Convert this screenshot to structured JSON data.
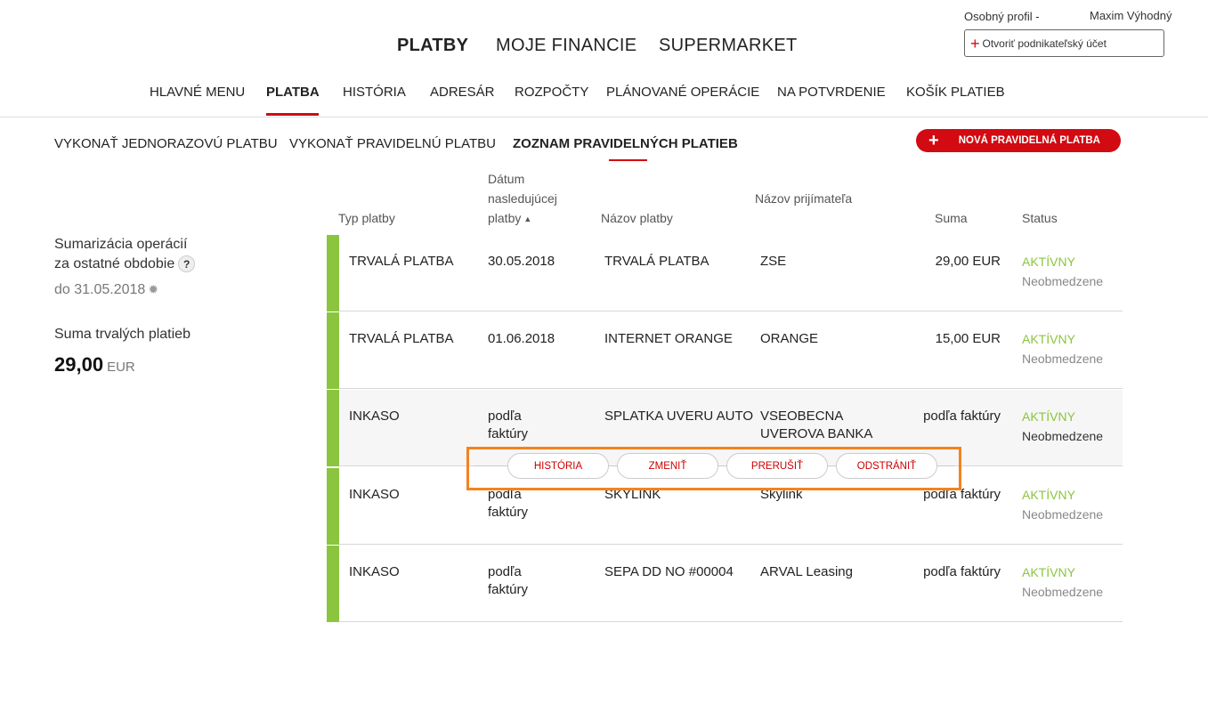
{
  "profile": {
    "label": "Osobný profil",
    "separator": "-",
    "name": "Maxim Výhodný",
    "business_button": "Otvoriť podnikateľský účet"
  },
  "top_nav": [
    "PLATBY",
    "MOJE FINANCIE",
    "SUPERMARKET"
  ],
  "sub_nav": [
    "HLAVNÉ MENU",
    "PLATBA",
    "HISTÓRIA",
    "ADRESÁR",
    "ROZPOČTY",
    "PLÁNOVANÉ OPERÁCIE",
    "NA POTVRDENIE",
    "KOŠÍK PLATIEB"
  ],
  "third_nav": [
    "VYKONAŤ JEDNORAZOVÚ PLATBU",
    "VYKONAŤ PRAVIDELNÚ PLATBU",
    "ZOZNAM PRAVIDELNÝCH PLATIEB"
  ],
  "new_button": "NOVÁ PRAVIDELNÁ PLATBA",
  "summary": {
    "title_line1": "Sumarizácia operácií",
    "title_line2": "za ostatné obdobie",
    "help": "?",
    "date": "do 31.05.2018",
    "sum_label": "Suma trvalých platieb",
    "sum_amount": "29,00",
    "sum_currency": "EUR"
  },
  "table": {
    "headers": {
      "type": "Typ platby",
      "date_l1": "Dátum",
      "date_l2": "nasledujúcej",
      "date_l3": "platby",
      "name": "Názov platby",
      "recipient": "Názov prijímateľa",
      "amount": "Suma",
      "status": "Status"
    },
    "rows": [
      {
        "type": "TRVALÁ PLATBA",
        "date": "30.05.2018",
        "date2": "",
        "name": "TRVALÁ PLATBA",
        "recipient": "ZSE",
        "recipient2": "",
        "amount": "29,00 EUR",
        "status": "AKTÍVNY",
        "status_sub": "Neobmedzene"
      },
      {
        "type": "TRVALÁ PLATBA",
        "date": "01.06.2018",
        "date2": "",
        "name": "INTERNET ORANGE",
        "recipient": "ORANGE",
        "recipient2": "",
        "amount": "15,00 EUR",
        "status": "AKTÍVNY",
        "status_sub": "Neobmedzene"
      },
      {
        "type": "INKASO",
        "date": "podľa",
        "date2": "faktúry",
        "name": "SPLATKA UVERU AUTO",
        "recipient": "VSEOBECNA",
        "recipient2": "UVEROVA BANKA",
        "amount": "podľa faktúry",
        "status": "AKTÍVNY",
        "status_sub": "Neobmedzene"
      },
      {
        "type": "INKASO",
        "date": "podľa",
        "date2": "faktúry",
        "name": "SKYLINK",
        "recipient": "Skylink",
        "recipient2": "",
        "amount": "podľa faktúry",
        "status": "AKTÍVNY",
        "status_sub": "Neobmedzene"
      },
      {
        "type": "INKASO",
        "date": "podľa",
        "date2": "faktúry",
        "name": "SEPA DD NO #00004",
        "recipient": "ARVAL Leasing",
        "recipient2": "",
        "amount": "podľa faktúry",
        "status": "AKTÍVNY",
        "status_sub": "Neobmedzene"
      }
    ]
  },
  "actions": [
    "HISTÓRIA",
    "ZMENIŤ",
    "PRERUŠIŤ",
    "ODSTRÁNIŤ"
  ],
  "colors": {
    "accent": "#d20a11",
    "status_active": "#8bc53f",
    "highlight_box": "#f5821f"
  }
}
